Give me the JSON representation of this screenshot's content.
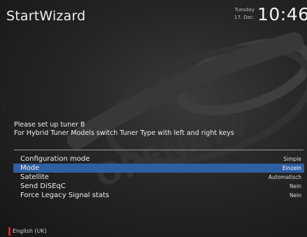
{
  "header": {
    "title": "StartWizard",
    "date_day": "Tuesday",
    "date": "17. Dec.",
    "time": "10:46"
  },
  "message": {
    "line1": "Please set up tuner B",
    "line2": "For Hybrid Tuner Models switch Tuner Type with left and right keys"
  },
  "config": {
    "rows": [
      {
        "label": "Configuration mode",
        "value": "Simple"
      },
      {
        "label": "Mode",
        "value": "Einzeln",
        "selected": true
      },
      {
        "label": "Satellite",
        "value": "Automatisch"
      },
      {
        "label": "Send DiSEqC",
        "value": "Nein"
      },
      {
        "label": "Force Legacy Signal stats",
        "value": "Nein"
      }
    ]
  },
  "footer": {
    "language": "English (UK)",
    "marker_color": "#d8202a"
  },
  "colors": {
    "selection": "#2f5fa3",
    "background": "#1a1a1a"
  }
}
